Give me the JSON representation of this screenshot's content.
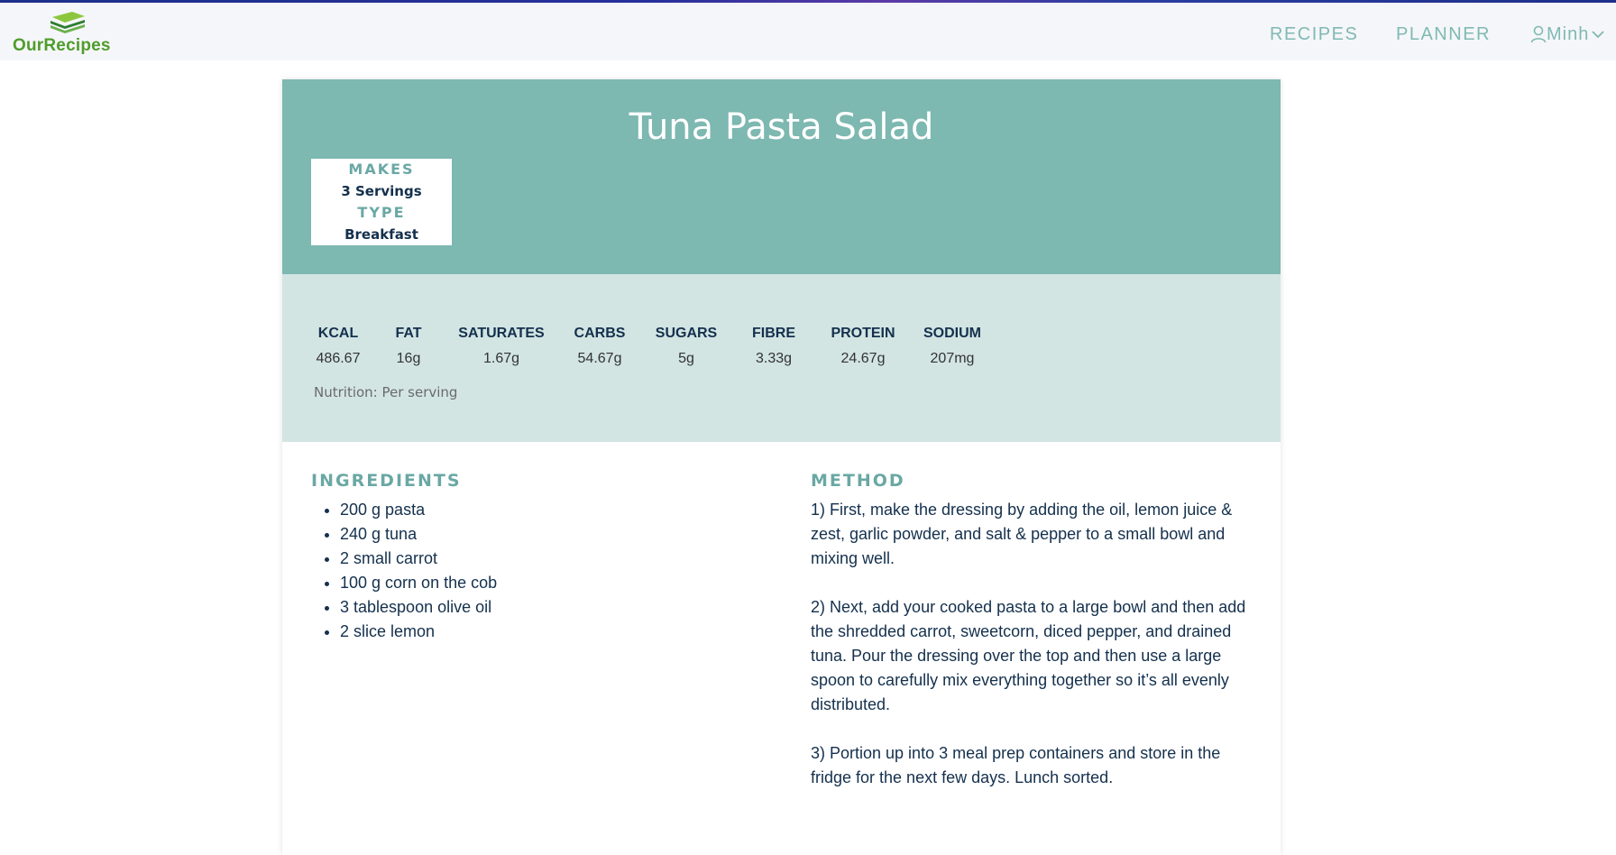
{
  "header": {
    "logo_text": "OurRecipes",
    "nav": [
      "RECIPES",
      "PLANNER"
    ],
    "user_name": "Minh"
  },
  "recipe": {
    "title": "Tuna Pasta Salad",
    "makes_label": "MAKES",
    "makes_value": "3 Servings",
    "type_label": "TYPE",
    "type_value": "Breakfast"
  },
  "nutrition": {
    "items": [
      {
        "label": "KCAL",
        "value": "486.67"
      },
      {
        "label": "FAT",
        "value": "16g"
      },
      {
        "label": "SATURATES",
        "value": "1.67g"
      },
      {
        "label": "CARBS",
        "value": "54.67g"
      },
      {
        "label": "SUGARS",
        "value": "5g"
      },
      {
        "label": "FIBRE",
        "value": "3.33g"
      },
      {
        "label": "PROTEIN",
        "value": "24.67g"
      },
      {
        "label": "SODIUM",
        "value": "207mg"
      }
    ],
    "note": "Nutrition: Per serving"
  },
  "ingredients": {
    "title": "INGREDIENTS",
    "items": [
      "200 g pasta",
      "240 g tuna",
      "2 small carrot",
      "100 g corn on the cob",
      "3 tablespoon olive oil",
      "2 slice lemon"
    ]
  },
  "method": {
    "title": "METHOD",
    "steps": [
      "1) First, make the dressing by adding the oil, lemon juice & zest, garlic powder, and salt & pepper to a small bowl and mixing well.",
      "2) Next, add your cooked pasta to a large bowl and then add the shredded carrot, sweetcorn, diced pepper, and drained tuna. Pour the dressing over the top and then use a large spoon to carefully mix everything together so it’s all evenly distributed.",
      "3) Portion up into 3 meal prep containers and store in the fridge for the next few days. Lunch sorted."
    ]
  },
  "colors": {
    "brand_green": "#4f9d2a",
    "accent_teal": "#7db8b1",
    "nutrition_bg": "#d2e5e3",
    "text_navy": "#14304d"
  }
}
